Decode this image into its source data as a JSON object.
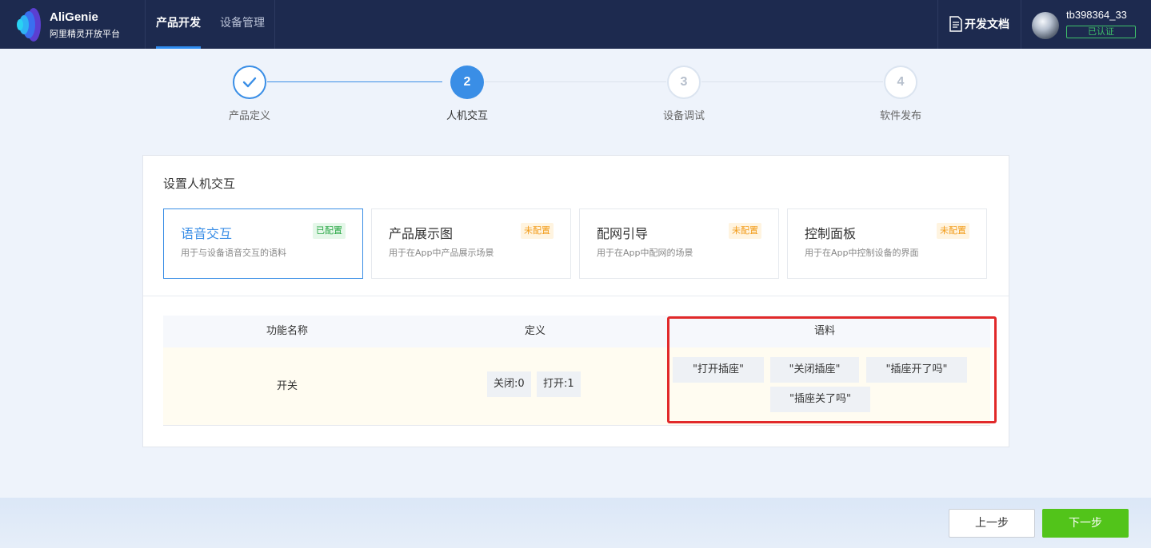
{
  "header": {
    "brand_name": "AliGenie",
    "brand_sub": "阿里精灵开放平台",
    "tabs": [
      {
        "label": "产品开发",
        "active": true
      },
      {
        "label": "设备管理",
        "active": false
      }
    ],
    "docs_label": "开发文档",
    "username": "tb398364_33",
    "verified_label": "已认证"
  },
  "steps": [
    {
      "number": "1",
      "label": "产品定义",
      "state": "done"
    },
    {
      "number": "2",
      "label": "人机交互",
      "state": "current"
    },
    {
      "number": "3",
      "label": "设备调试",
      "state": "todo"
    },
    {
      "number": "4",
      "label": "软件发布",
      "state": "todo"
    }
  ],
  "section_title": "设置人机交互",
  "interaction_types": [
    {
      "name": "语音交互",
      "status": "已配置",
      "desc": "用于与设备语音交互的语料",
      "active": true
    },
    {
      "name": "产品展示图",
      "status": "未配置",
      "desc": "用于在App中产品展示场景",
      "active": false
    },
    {
      "name": "配网引导",
      "status": "未配置",
      "desc": "用于在App中配网的场景",
      "active": false
    },
    {
      "name": "控制面板",
      "status": "未配置",
      "desc": "用于在App中控制设备的界面",
      "active": false
    }
  ],
  "table": {
    "headers": [
      "功能名称",
      "定义",
      "语料"
    ],
    "rows": [
      {
        "name": "开关",
        "definitions": [
          "关闭:0",
          "打开:1"
        ],
        "corpus": [
          "\"打开插座\"",
          "\"关闭插座\"",
          "\"插座开了吗\"",
          "\"插座关了吗\""
        ]
      }
    ]
  },
  "buttons": {
    "prev": "上一步",
    "next": "下一步"
  },
  "colors": {
    "accent": "#3a8ee6",
    "nav_bg": "#1d2a4f",
    "success": "#52c41a",
    "warning": "#f29b19",
    "highlight": "#e1292a"
  }
}
